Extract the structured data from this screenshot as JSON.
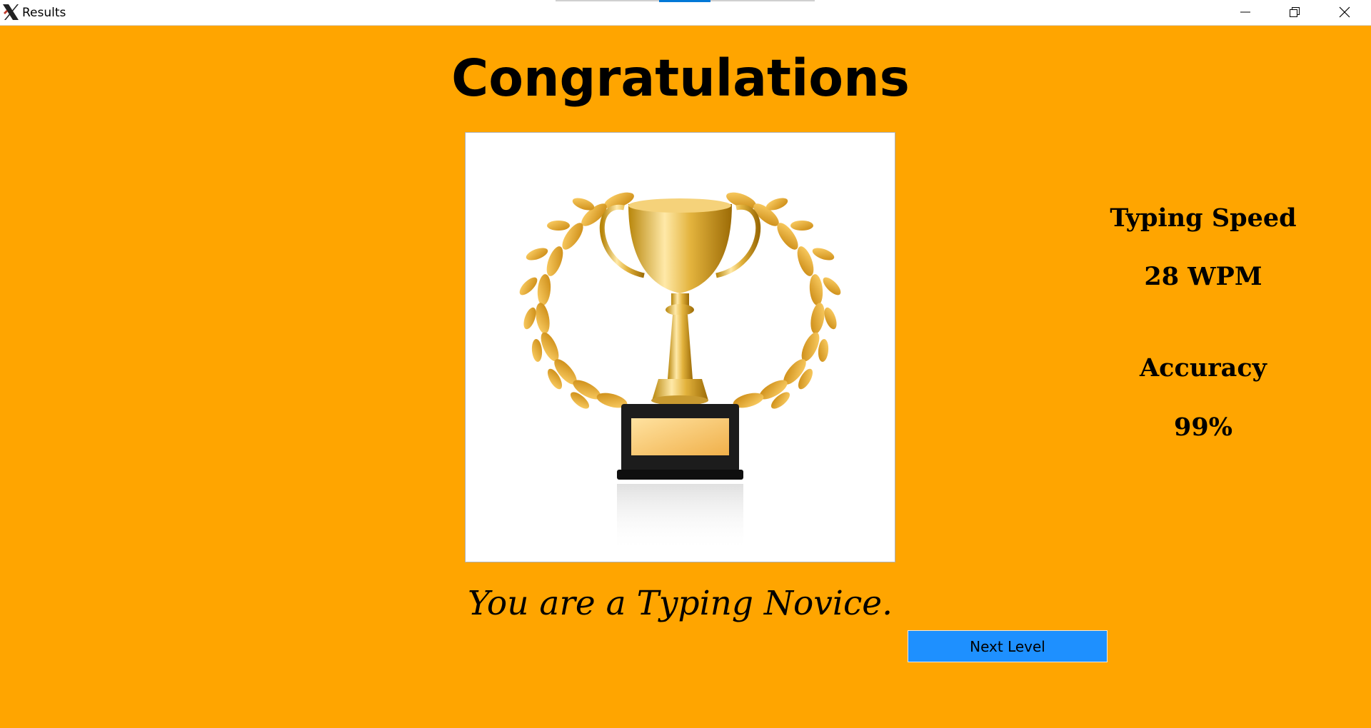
{
  "window": {
    "title": "Results",
    "icons": {
      "app": "x-logo-icon",
      "minimize": "minimize-icon",
      "maximize": "restore-icon",
      "close": "close-icon"
    }
  },
  "main": {
    "heading": "Congratulations",
    "image": "trophy-with-laurel-wreath",
    "rank_message": "You are a Typing Novice.",
    "stats": {
      "speed_label": "Typing Speed",
      "speed_value": "28 WPM",
      "accuracy_label": "Accuracy",
      "accuracy_value": "99%"
    },
    "next_button_label": "Next Level"
  },
  "colors": {
    "background": "#FFA500",
    "button": "#1E90FF",
    "panel": "#FFFFFF"
  }
}
